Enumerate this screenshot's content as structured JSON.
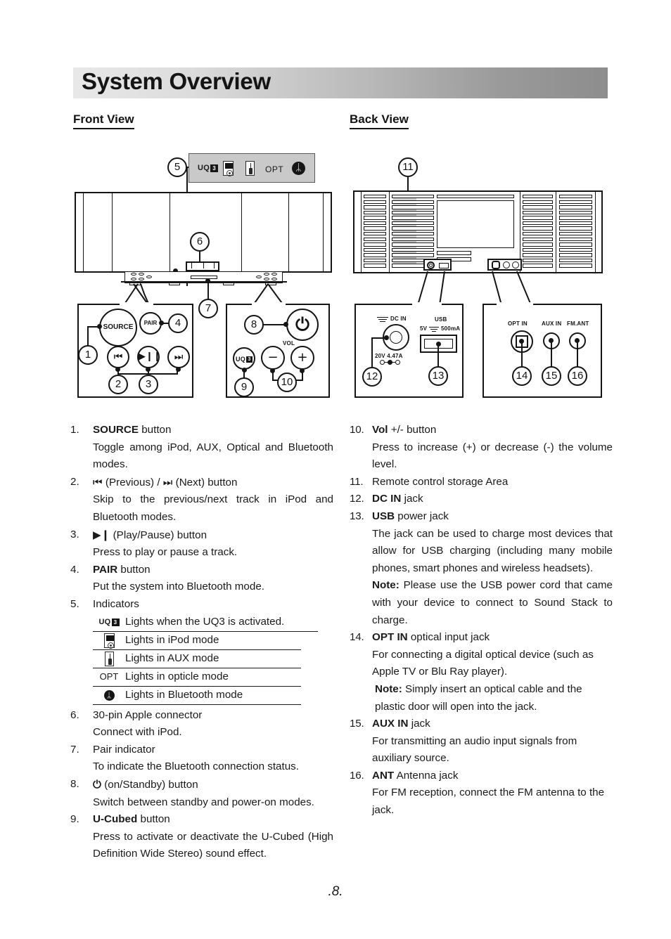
{
  "header": {
    "title": "System Overview"
  },
  "sections": {
    "front_view_heading": "Front View",
    "back_view_heading": "Back View"
  },
  "front_diagram": {
    "indicator_panel": {
      "uq3_label": "UQ",
      "uq3_badge": "3",
      "opt_label": "OPT",
      "bluetooth_glyph": "ᛦ",
      "icons": [
        "uq3-indicator-icon",
        "ipod-indicator-icon",
        "aux-indicator-icon",
        "opt-indicator-label",
        "bluetooth-indicator-icon"
      ]
    },
    "callouts": [
      "5",
      "6",
      "7",
      "1",
      "2",
      "3",
      "4",
      "8",
      "9",
      "10"
    ],
    "buttons": {
      "source": "SOURCE",
      "pair": "PAIR",
      "previous": "⏮",
      "play_pause": "▶❙❙",
      "next": "⏭",
      "power": "⏻",
      "u_cubed": "UQ",
      "u_cubed_badge": "3",
      "vol_label": "VOL",
      "vol_minus": "−",
      "vol_plus": "+"
    }
  },
  "back_diagram": {
    "callouts": [
      "11",
      "12",
      "13",
      "14",
      "15",
      "16"
    ],
    "labels": {
      "dc_in": "DC IN",
      "dc_rating": "20V  4.47A",
      "usb": "USB",
      "usb_rating_left": "5V",
      "usb_rating_right": "500mA",
      "opt_in": "OPT IN",
      "aux_in": "AUX IN",
      "fm_ant": "FM.ANT"
    }
  },
  "left_items": [
    {
      "num": "1.",
      "head_bold": "SOURCE",
      "head_rest": " button",
      "body": "Toggle among iPod, AUX, Optical and Bluetooth modes."
    },
    {
      "num": "2.",
      "head_icon_prev": "⏮",
      "head_prev_text": " (Previous) / ",
      "head_icon_next": "⏭",
      "head_next_text": " (Next) button",
      "body": "Skip to the previous/next track in iPod and Bluetooth modes."
    },
    {
      "num": "3.",
      "head_icon": "▶❙",
      "head_rest": "  (Play/Pause) button",
      "body": "Press to play or pause a track."
    },
    {
      "num": "4.",
      "head_bold": "PAIR",
      "head_rest": " button",
      "body": "Put the system into Bluetooth mode."
    },
    {
      "num": "5.",
      "head_rest": "Indicators",
      "indicators": [
        {
          "icon": "uq3-icon",
          "text": "Lights when the UQ3 is activated."
        },
        {
          "icon": "ipod-icon",
          "text": "Lights in iPod mode"
        },
        {
          "icon": "aux-icon",
          "text": "Lights in AUX mode"
        },
        {
          "icon": "opt-icon",
          "text": "Lights in opticle mode"
        },
        {
          "icon": "bluetooth-icon",
          "text": "Lights in Bluetooth mode"
        }
      ]
    },
    {
      "num": "6.",
      "head_rest": "30-pin Apple connector",
      "body": "Connect with iPod."
    },
    {
      "num": "7.",
      "head_rest": "Pair indicator",
      "body": "To indicate the Bluetooth connection status."
    },
    {
      "num": "8.",
      "head_icon": "⏻",
      "head_rest": " (on/Standby) button",
      "body": "Switch between standby and power-on modes."
    },
    {
      "num": "9.",
      "head_bold": "U-Cubed",
      "head_rest": " button",
      "body": "Press to activate or deactivate the U-Cubed (High Definition Wide Stereo) sound effect."
    }
  ],
  "right_items": [
    {
      "num": "10.",
      "head_bold": "Vol",
      "head_rest": " +/- button",
      "body": "Press to increase (+) or decrease (-) the volume level."
    },
    {
      "num": "11.",
      "head_rest": "Remote control storage Area"
    },
    {
      "num": "12.",
      "head_bold": "DC IN",
      "head_rest": " jack"
    },
    {
      "num": "13.",
      "head_bold": "USB",
      "head_rest": " power jack",
      "body": "The jack can be used to charge most devices that allow for USB charging (including many mobile phones, smart phones and wireless headsets).",
      "note_label": "Note:",
      "note_body": " Please use the USB power cord that came with your device to connect to Sound Stack to charge."
    },
    {
      "num": "14.",
      "head_bold": "OPT IN",
      "head_rest": " optical input jack",
      "body": "For connecting a digital optical device (such as Apple TV or Blu Ray player).",
      "note_label": "Note:",
      "note_body": " Simply insert an optical cable and the plastic door will open into the jack."
    },
    {
      "num": "15.",
      "head_bold": "AUX IN",
      "head_rest": " jack",
      "body": "For transmitting an audio input signals from auxiliary source."
    },
    {
      "num": "16.",
      "head_bold": "ANT",
      "head_rest": " Antenna jack",
      "body": "For FM reception, connect the FM antenna to the jack."
    }
  ],
  "footer": {
    "page_number": ".8."
  }
}
